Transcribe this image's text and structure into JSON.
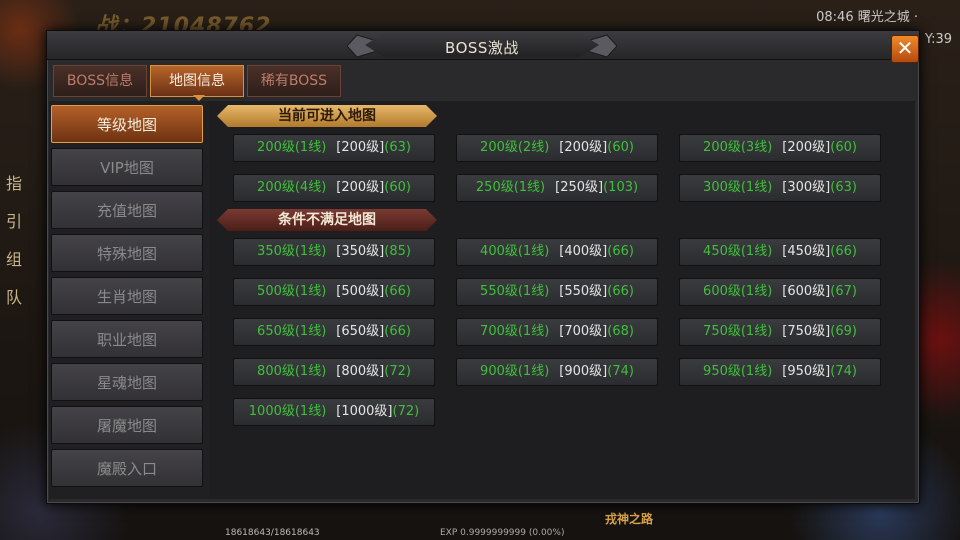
{
  "background": {
    "combat_text": "战：21048762",
    "clock": "08:46  曙光之城 ·",
    "y_label": "Y:39",
    "side_text": [
      "指",
      "引",
      "组",
      "队"
    ],
    "hp_text": "18618643/18618643",
    "exp_text": "EXP 0.9999999999 (0.00%)",
    "bottom_logo": "戎神之路"
  },
  "window": {
    "title": "BOSS激战",
    "close_label": "✕"
  },
  "tabs": [
    {
      "label": "BOSS信息",
      "active": false
    },
    {
      "label": "地图信息",
      "active": true
    },
    {
      "label": "稀有BOSS",
      "active": false
    }
  ],
  "left_nav": [
    {
      "label": "等级地图",
      "active": true
    },
    {
      "label": "VIP地图",
      "active": false
    },
    {
      "label": "充值地图",
      "active": false
    },
    {
      "label": "特殊地图",
      "active": false
    },
    {
      "label": "生肖地图",
      "active": false
    },
    {
      "label": "职业地图",
      "active": false
    },
    {
      "label": "星魂地图",
      "active": false
    },
    {
      "label": "屠魔地图",
      "active": false
    },
    {
      "label": "魔殿入口",
      "active": false
    }
  ],
  "sections": {
    "available_title": "当前可进入地图",
    "unavailable_title": "条件不满足地图"
  },
  "available_maps": [
    {
      "name": "200级(1线)",
      "level": "[200级]",
      "count": "(63)"
    },
    {
      "name": "200级(2线)",
      "level": "[200级]",
      "count": "(60)"
    },
    {
      "name": "200级(3线)",
      "level": "[200级]",
      "count": "(60)"
    },
    {
      "name": "200级(4线)",
      "level": "[200级]",
      "count": "(60)"
    },
    {
      "name": "250级(1线)",
      "level": "[250级]",
      "count": "(103)"
    },
    {
      "name": "300级(1线)",
      "level": "[300级]",
      "count": "(63)"
    }
  ],
  "unavailable_maps": [
    {
      "name": "350级(1线)",
      "level": "[350级]",
      "count": "(85)"
    },
    {
      "name": "400级(1线)",
      "level": "[400级]",
      "count": "(66)"
    },
    {
      "name": "450级(1线)",
      "level": "[450级]",
      "count": "(66)"
    },
    {
      "name": "500级(1线)",
      "level": "[500级]",
      "count": "(66)"
    },
    {
      "name": "550级(1线)",
      "level": "[550级]",
      "count": "(66)"
    },
    {
      "name": "600级(1线)",
      "level": "[600级]",
      "count": "(67)"
    },
    {
      "name": "650级(1线)",
      "level": "[650级]",
      "count": "(66)"
    },
    {
      "name": "700级(1线)",
      "level": "[700级]",
      "count": "(68)"
    },
    {
      "name": "750级(1线)",
      "level": "[750级]",
      "count": "(69)"
    },
    {
      "name": "800级(1线)",
      "level": "[800级]",
      "count": "(72)"
    },
    {
      "name": "900级(1线)",
      "level": "[900级]",
      "count": "(74)"
    },
    {
      "name": "950级(1线)",
      "level": "[950级]",
      "count": "(74)"
    },
    {
      "name": "1000级(1线)",
      "level": "[1000级]",
      "count": "(72)"
    }
  ],
  "colors": {
    "accent": "#d9903a",
    "name_green": "#3ec03a",
    "level_white": "#e4e4e4"
  }
}
